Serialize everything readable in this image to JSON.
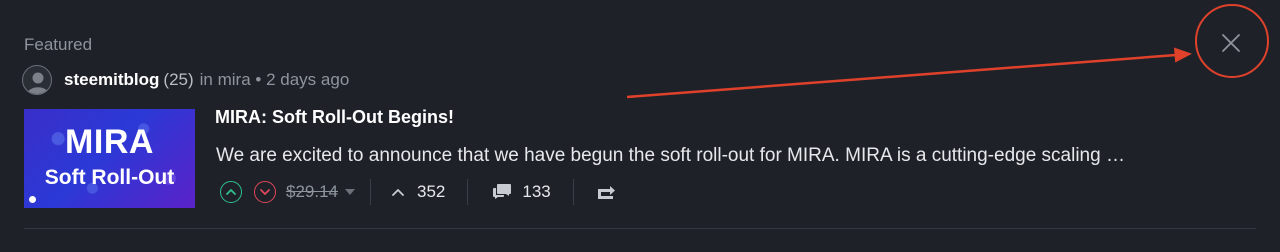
{
  "featured": {
    "label": "Featured"
  },
  "author": {
    "name": "steemitblog",
    "reputation": "(25)",
    "meta_prefix": "in",
    "community": "mira",
    "separator": "•",
    "time": "2 days ago"
  },
  "thumbnail": {
    "line1": "MIRA",
    "line2": "Soft Roll-Out"
  },
  "post": {
    "title": "MIRA: Soft Roll-Out Begins!",
    "excerpt": "We are excited to announce that we have begun the soft roll-out for MIRA. MIRA is a cutting-edge scaling …"
  },
  "actions": {
    "payout": "$29.14",
    "votes": "352",
    "comments": "133"
  },
  "icons": {
    "upvote": "chevron-up-circle-icon",
    "downvote": "chevron-down-circle-icon",
    "payout_caret": "caret-down-icon",
    "votes": "chevron-up-icon",
    "comments": "comment-bubbles-icon",
    "reblog": "reblog-icon",
    "close": "close-icon",
    "avatar": "user-avatar-icon"
  },
  "colors": {
    "background": "#1e2228",
    "upvote": "#2fbf8f",
    "downvote": "#e0475b",
    "annotation": "#e0412b"
  }
}
